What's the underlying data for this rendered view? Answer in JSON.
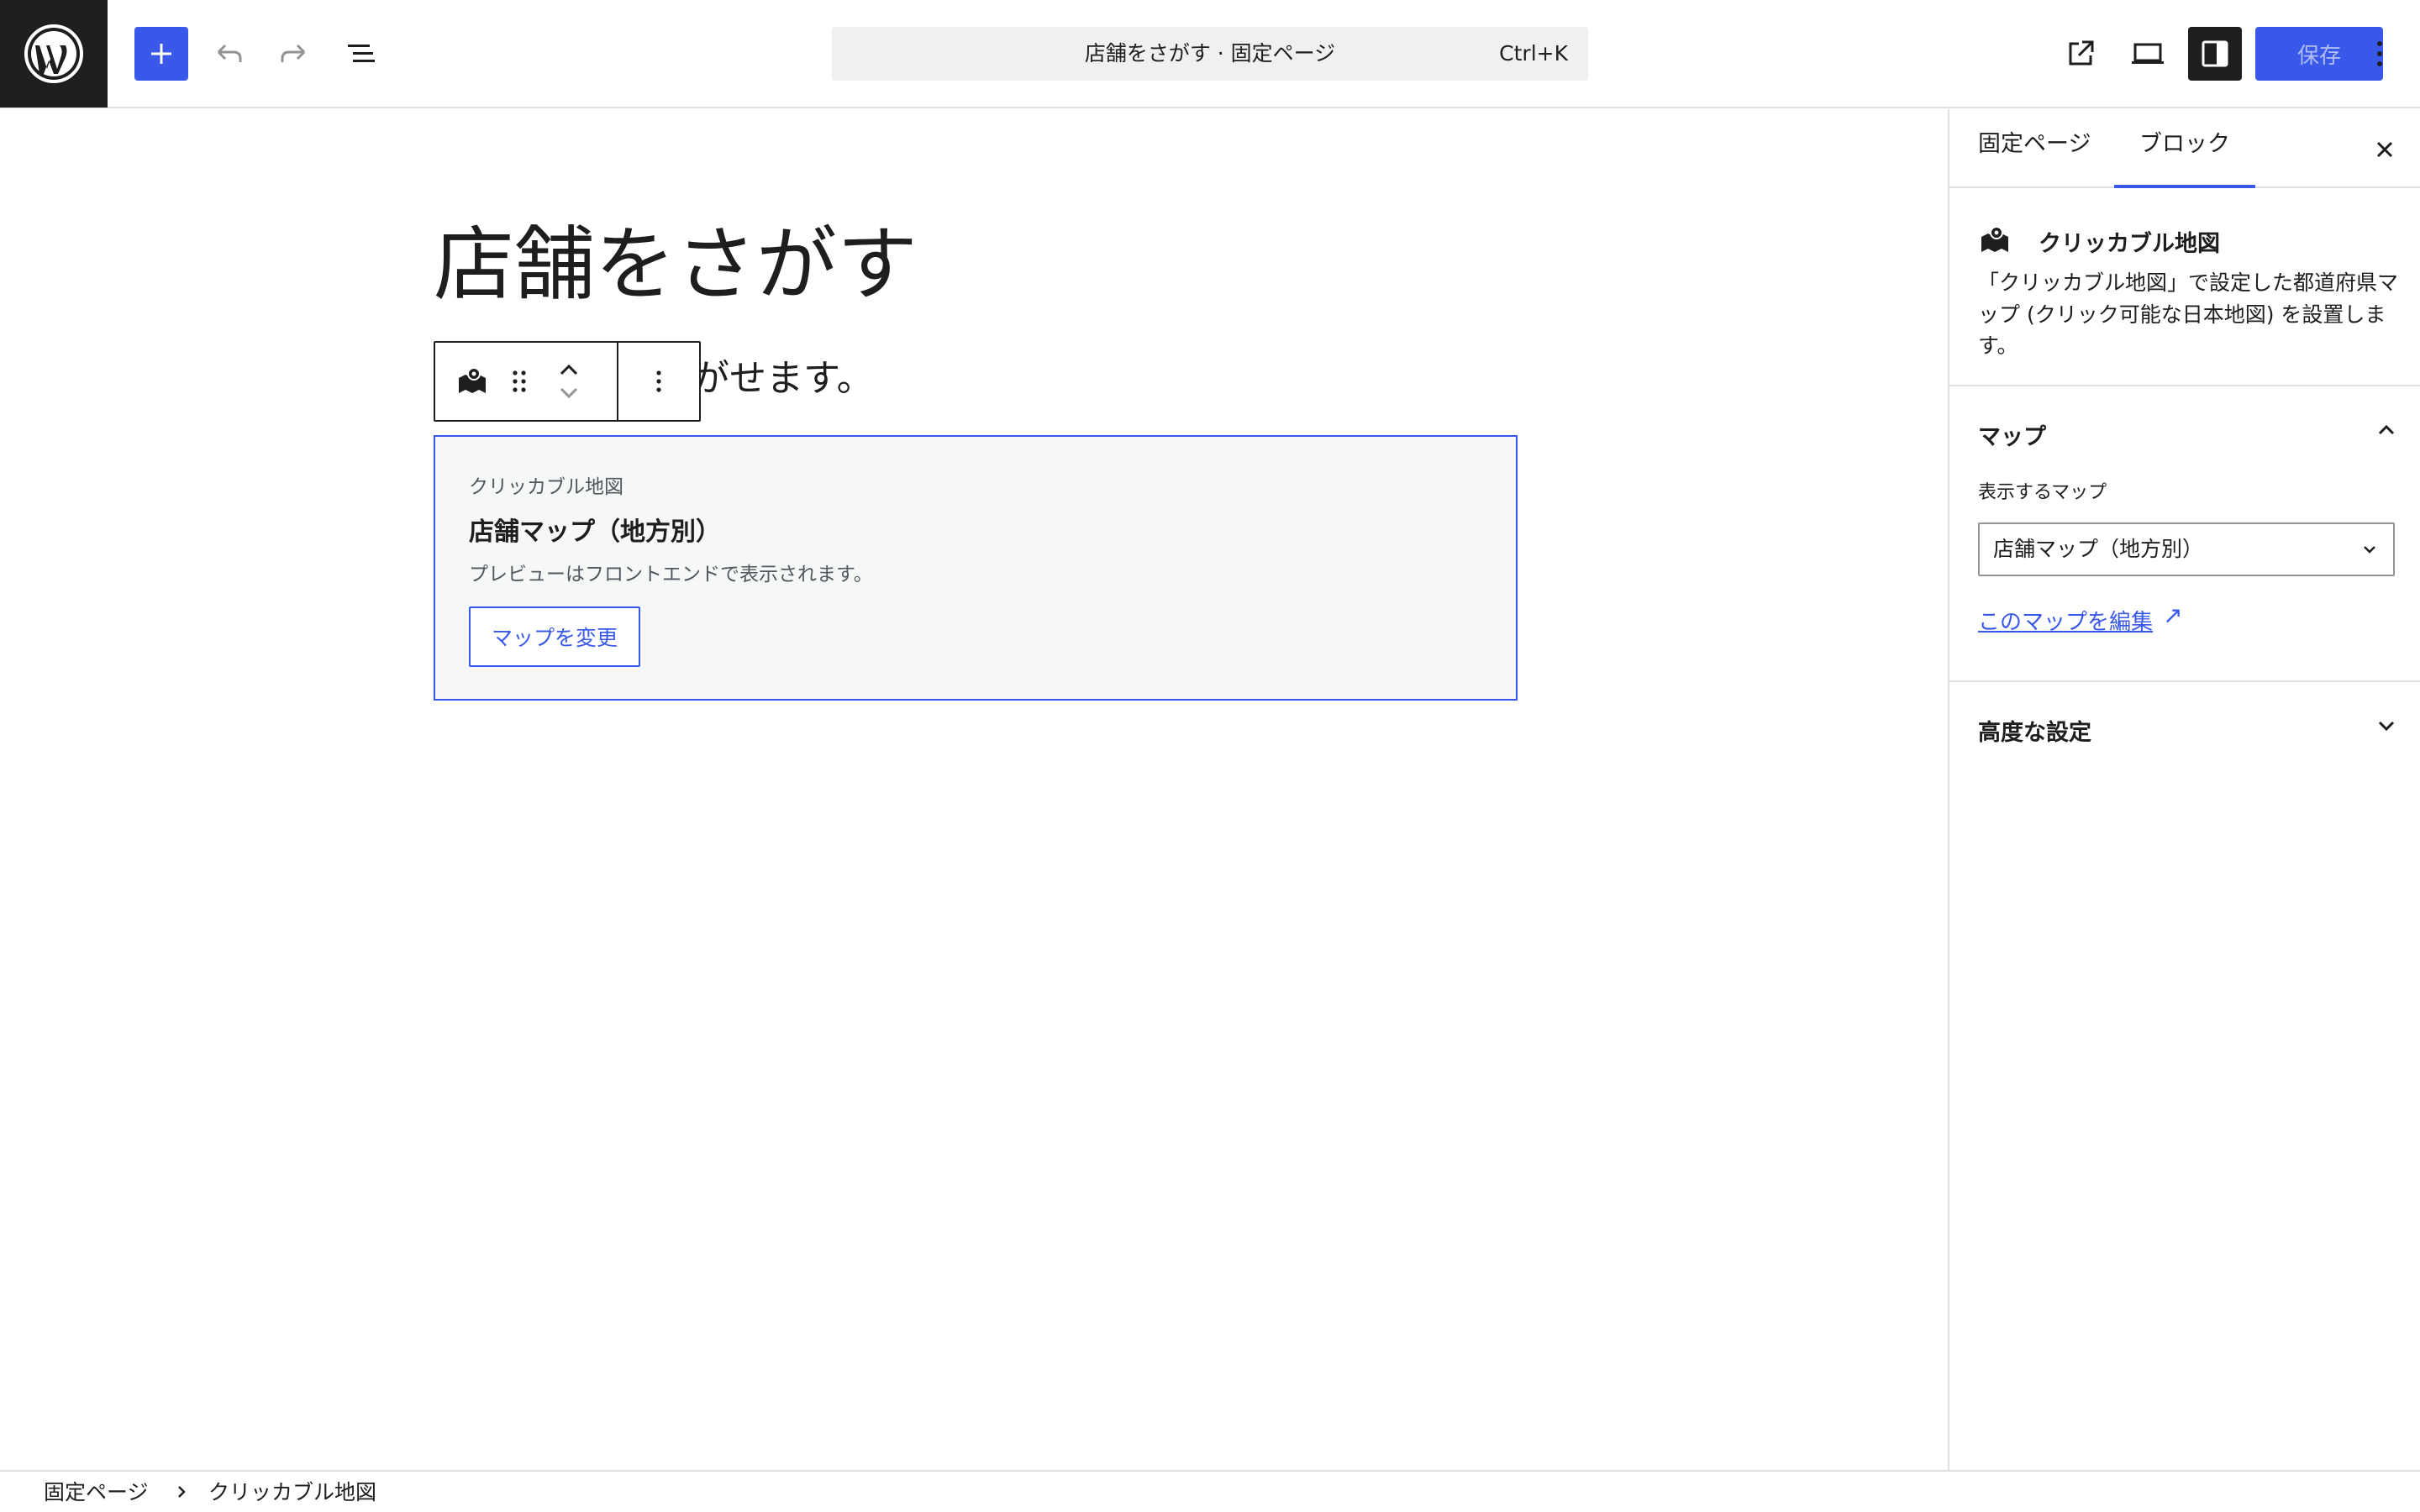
{
  "header": {
    "command_title": "店舗をさがす · 固定ページ",
    "command_shortcut": "Ctrl+K",
    "save_label": "保存"
  },
  "editor": {
    "page_title": "店舗をさがす",
    "paragraph": "下の地図からさがせます。",
    "map_block": {
      "label": "クリッカブル地図",
      "name": "店舗マップ（地方別）",
      "description": "プレビューはフロントエンドで表示されます。",
      "change_button": "マップを変更"
    }
  },
  "sidebar": {
    "tabs": [
      {
        "label": "固定ページ"
      },
      {
        "label": "ブロック"
      }
    ],
    "block_card": {
      "title": "クリッカブル地図",
      "description": "「クリッカブル地図」で設定した都道府県マップ (クリック可能な日本地図) を設置します。"
    },
    "map_panel": {
      "title": "マップ",
      "field_label": "表示するマップ",
      "selected_map": "店舗マップ（地方別）",
      "edit_link": "このマップを編集",
      "edit_link_arrow": "↗"
    },
    "advanced_panel": {
      "title": "高度な設定"
    }
  },
  "footer": {
    "breadcrumb": [
      "固定ページ",
      "クリッカブル地図"
    ]
  },
  "colors": {
    "accent": "#3858e9",
    "dark": "#1e1e1e",
    "border": "#e0e0e0",
    "block_bg": "#f6f7f7"
  }
}
